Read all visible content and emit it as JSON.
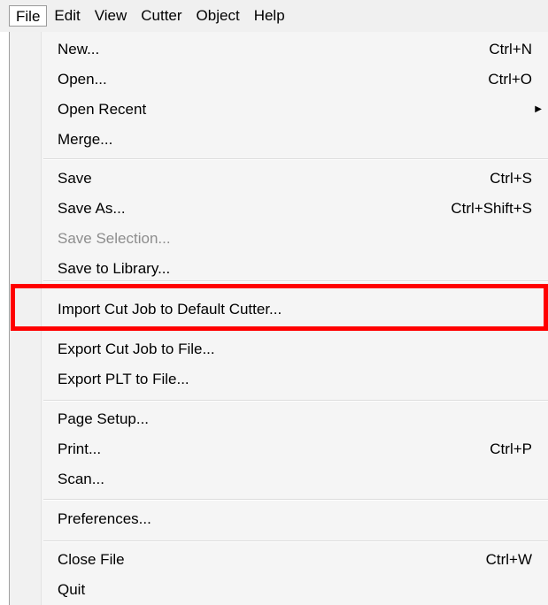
{
  "menubar": {
    "items": [
      {
        "label": "File"
      },
      {
        "label": "Edit"
      },
      {
        "label": "View"
      },
      {
        "label": "Cutter"
      },
      {
        "label": "Object"
      },
      {
        "label": "Help"
      }
    ]
  },
  "file_menu": {
    "new": {
      "label": "New...",
      "shortcut": "Ctrl+N"
    },
    "open": {
      "label": "Open...",
      "shortcut": "Ctrl+O"
    },
    "open_recent": {
      "label": "Open Recent",
      "submenu_icon": "right-triangle-icon"
    },
    "merge": {
      "label": "Merge..."
    },
    "save": {
      "label": "Save",
      "shortcut": "Ctrl+S"
    },
    "save_as": {
      "label": "Save As...",
      "shortcut": "Ctrl+Shift+S"
    },
    "save_selection": {
      "label": "Save Selection...",
      "disabled": true
    },
    "save_to_library": {
      "label": "Save to Library..."
    },
    "import_cut_job": {
      "label": "Import Cut Job to Default Cutter..."
    },
    "export_cut_job": {
      "label": "Export Cut Job to File..."
    },
    "export_plt": {
      "label": "Export PLT to File..."
    },
    "page_setup": {
      "label": "Page Setup..."
    },
    "print": {
      "label": "Print...",
      "shortcut": "Ctrl+P"
    },
    "scan": {
      "label": "Scan..."
    },
    "preferences": {
      "label": "Preferences..."
    },
    "close_file": {
      "label": "Close File",
      "shortcut": "Ctrl+W"
    },
    "quit": {
      "label": "Quit"
    }
  },
  "colors": {
    "highlight_outline": "#ff0000",
    "disabled_text": "#8d8d8d",
    "menu_background": "#f5f5f5"
  }
}
